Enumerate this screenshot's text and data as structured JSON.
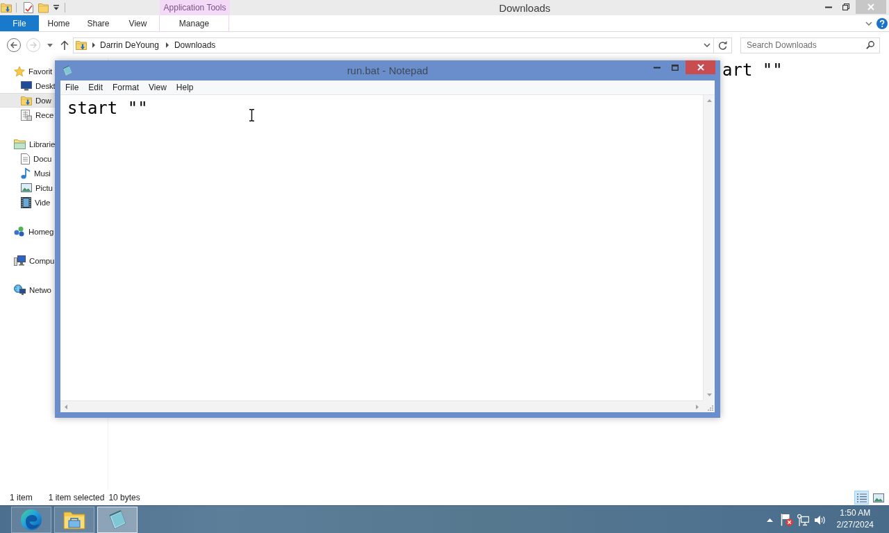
{
  "explorer": {
    "context_group": {
      "label": "Application Tools"
    },
    "title": "Downloads",
    "ribbon_tabs": [
      {
        "label": "File",
        "kind": "backstage"
      },
      {
        "label": "Home",
        "kind": "tab"
      },
      {
        "label": "Share",
        "kind": "tab"
      },
      {
        "label": "View",
        "kind": "tab"
      },
      {
        "label": "Manage",
        "kind": "context"
      }
    ],
    "history": [
      {
        "kind": "back",
        "disabled": false
      },
      {
        "kind": "forward",
        "disabled": true
      }
    ],
    "address": {
      "crumbs": [
        "Darrin DeYoung",
        "Downloads"
      ]
    },
    "search": {
      "placeholder": "Search Downloads"
    },
    "nav": [
      {
        "label": "Favorit",
        "kind": "favorites",
        "selected": false,
        "children": [
          {
            "label": "Deskt",
            "kind": "desktop",
            "selected": false
          },
          {
            "label": "Dow",
            "kind": "downloads",
            "selected": true
          },
          {
            "label": "Rece",
            "kind": "recent",
            "selected": false
          }
        ]
      },
      {
        "label": "Librarie",
        "kind": "libraries",
        "selected": false,
        "children": [
          {
            "label": "Docu",
            "kind": "documents",
            "selected": false
          },
          {
            "label": "Musi",
            "kind": "music",
            "selected": false
          },
          {
            "label": "Pictu",
            "kind": "pictures",
            "selected": false
          },
          {
            "label": "Vide",
            "kind": "videos",
            "selected": false
          }
        ]
      },
      {
        "label": "Homeg",
        "kind": "homegroup",
        "selected": false
      },
      {
        "label": "Compu",
        "kind": "computer",
        "selected": false
      },
      {
        "label": "Netwo",
        "kind": "network",
        "selected": false
      }
    ],
    "preview_text": "art \"\"",
    "status_bar": {
      "item_count": "1 item",
      "selection": "1 item selected",
      "size": "10 bytes"
    },
    "view_buttons": [
      {
        "kind": "details",
        "selected": true
      },
      {
        "kind": "large_icons",
        "selected": false
      }
    ]
  },
  "notepad": {
    "title": "run.bat - Notepad",
    "menu": [
      "File",
      "Edit",
      "Format",
      "View",
      "Help"
    ],
    "text": "start \"\""
  },
  "taskbar": {
    "apps": [
      {
        "kind": "browser",
        "selected": false
      },
      {
        "kind": "explorer",
        "selected": false
      },
      {
        "kind": "notepad",
        "selected": true
      }
    ],
    "clock": {
      "time": "1:50 AM",
      "date": "2/27/2024"
    }
  }
}
